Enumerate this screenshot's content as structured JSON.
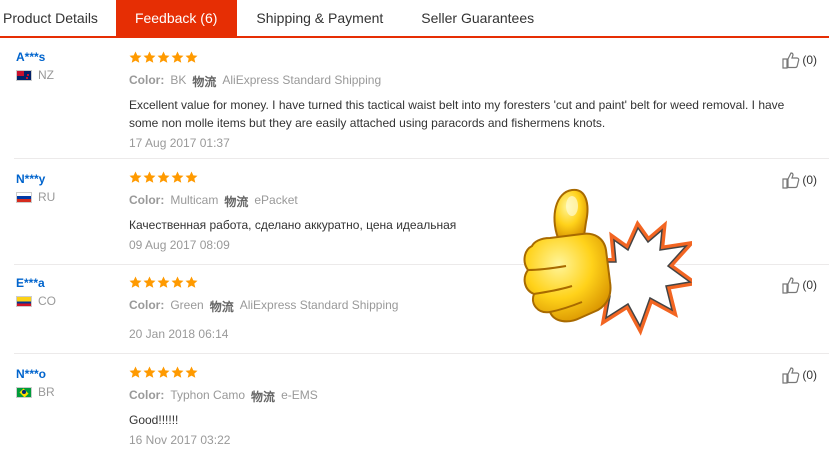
{
  "tabs": [
    {
      "label": "Product Details",
      "active": false
    },
    {
      "label": "Feedback (6)",
      "active": true
    },
    {
      "label": "Shipping & Payment",
      "active": false
    },
    {
      "label": "Seller Guarantees",
      "active": false
    }
  ],
  "labels": {
    "color": "Color:",
    "shipping": "物流"
  },
  "rating": {
    "stars": 5,
    "color": "#ff9a00"
  },
  "colors": {
    "accent": "#e62e04",
    "link": "#0064cd"
  },
  "reviews": [
    {
      "user": "A***s",
      "country": "NZ",
      "color": "BK",
      "shipping": "AliExpress Standard Shipping",
      "text": "Excellent value for money. I have turned this tactical waist belt into my foresters 'cut and paint' belt for weed removal. I have some non molle items but they are easily attached using paracords and fishermens knots.",
      "date": "17 Aug 2017 01:37",
      "likes": "(0)"
    },
    {
      "user": "N***y",
      "country": "RU",
      "color": "Multicam",
      "shipping": "ePacket",
      "text": "Качественная работа, сделано аккуратно, цена идеальная",
      "date": "09 Aug 2017 08:09",
      "likes": "(0)"
    },
    {
      "user": "E***a",
      "country": "CO",
      "color": "Green",
      "shipping": "AliExpress Standard Shipping",
      "text": "",
      "date": "20 Jan 2018 06:14",
      "likes": "(0)"
    },
    {
      "user": "N***o",
      "country": "BR",
      "color": "Typhon Camo",
      "shipping": "e-EMS",
      "text": "Good!!!!!!",
      "date": "16 Nov 2017 03:22",
      "likes": "(0)"
    }
  ],
  "icons": {
    "rating": "star-icon",
    "like": "thumbs-up-icon",
    "sticker": "thumbs-up-sticker"
  }
}
